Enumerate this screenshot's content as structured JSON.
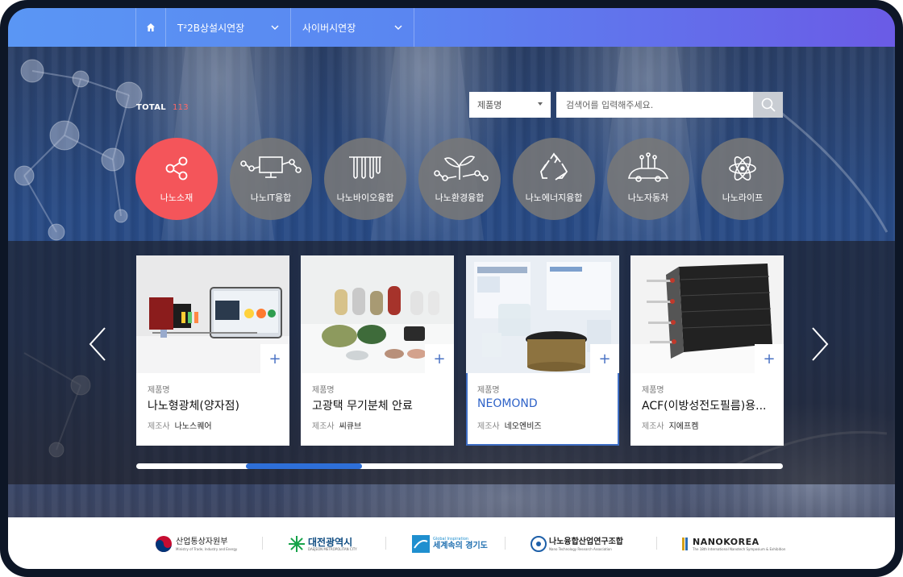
{
  "nav": {
    "home_icon": "home-icon",
    "menus": [
      {
        "label": "T²2B상설시연장"
      },
      {
        "label": "사이버시연장"
      }
    ]
  },
  "summary": {
    "total_label": "TOTAL",
    "total_count": "113"
  },
  "search": {
    "category_selected": "제품명",
    "placeholder": "검색어를 입력해주세요.",
    "button_icon": "search-icon"
  },
  "categories": [
    {
      "label": "나노소재",
      "icon": "share-nodes-icon",
      "active": true
    },
    {
      "label": "나노IT융합",
      "icon": "monitor-network-icon",
      "active": false
    },
    {
      "label": "나노바이오융합",
      "icon": "test-tubes-icon",
      "active": false
    },
    {
      "label": "나노환경융합",
      "icon": "sprout-network-icon",
      "active": false
    },
    {
      "label": "나노에너지융합",
      "icon": "recycle-icon",
      "active": false
    },
    {
      "label": "나노자동차",
      "icon": "car-sensor-icon",
      "active": false
    },
    {
      "label": "나노라이프",
      "icon": "atom-icon",
      "active": false
    }
  ],
  "products": [
    {
      "name_label": "제품명",
      "name": "나노형광체(양자점)",
      "maker_label": "제조사",
      "maker": "나노스퀘어"
    },
    {
      "name_label": "제품명",
      "name": "고광택 무기분체 안료",
      "maker_label": "제조사",
      "maker": "씨큐브"
    },
    {
      "name_label": "제품명",
      "name": "NEOMOND",
      "maker_label": "제조사",
      "maker": "네오엔비즈"
    },
    {
      "name_label": "제품명",
      "name": "ACF(이방성전도필름)용...",
      "maker_label": "제조사",
      "maker": "지에프켐"
    }
  ],
  "carousel": {
    "plus_symbol": "+",
    "scroll_position": 0.17,
    "visible_fraction": 0.18
  },
  "footer": {
    "logos": [
      {
        "name": "산업통상자원부",
        "sub": "Ministry of Trade, Industry and Energy"
      },
      {
        "name": "대전광역시",
        "sub": "DAEJEON METROPOLITAN CITY"
      },
      {
        "name": "세계속의 경기도",
        "sub": "Global Inspiration"
      },
      {
        "name": "나노융합산업연구조합",
        "sub": "Nano Technology Research Association"
      },
      {
        "name": "NANOKOREA",
        "sub": "The 18th International Nanotech Symposium & Exhibition"
      }
    ]
  },
  "colors": {
    "accent": "#f4555a",
    "brand_blue": "#2e6fd8",
    "nav_start": "#5a96f4",
    "nav_end": "#6a5be6"
  }
}
